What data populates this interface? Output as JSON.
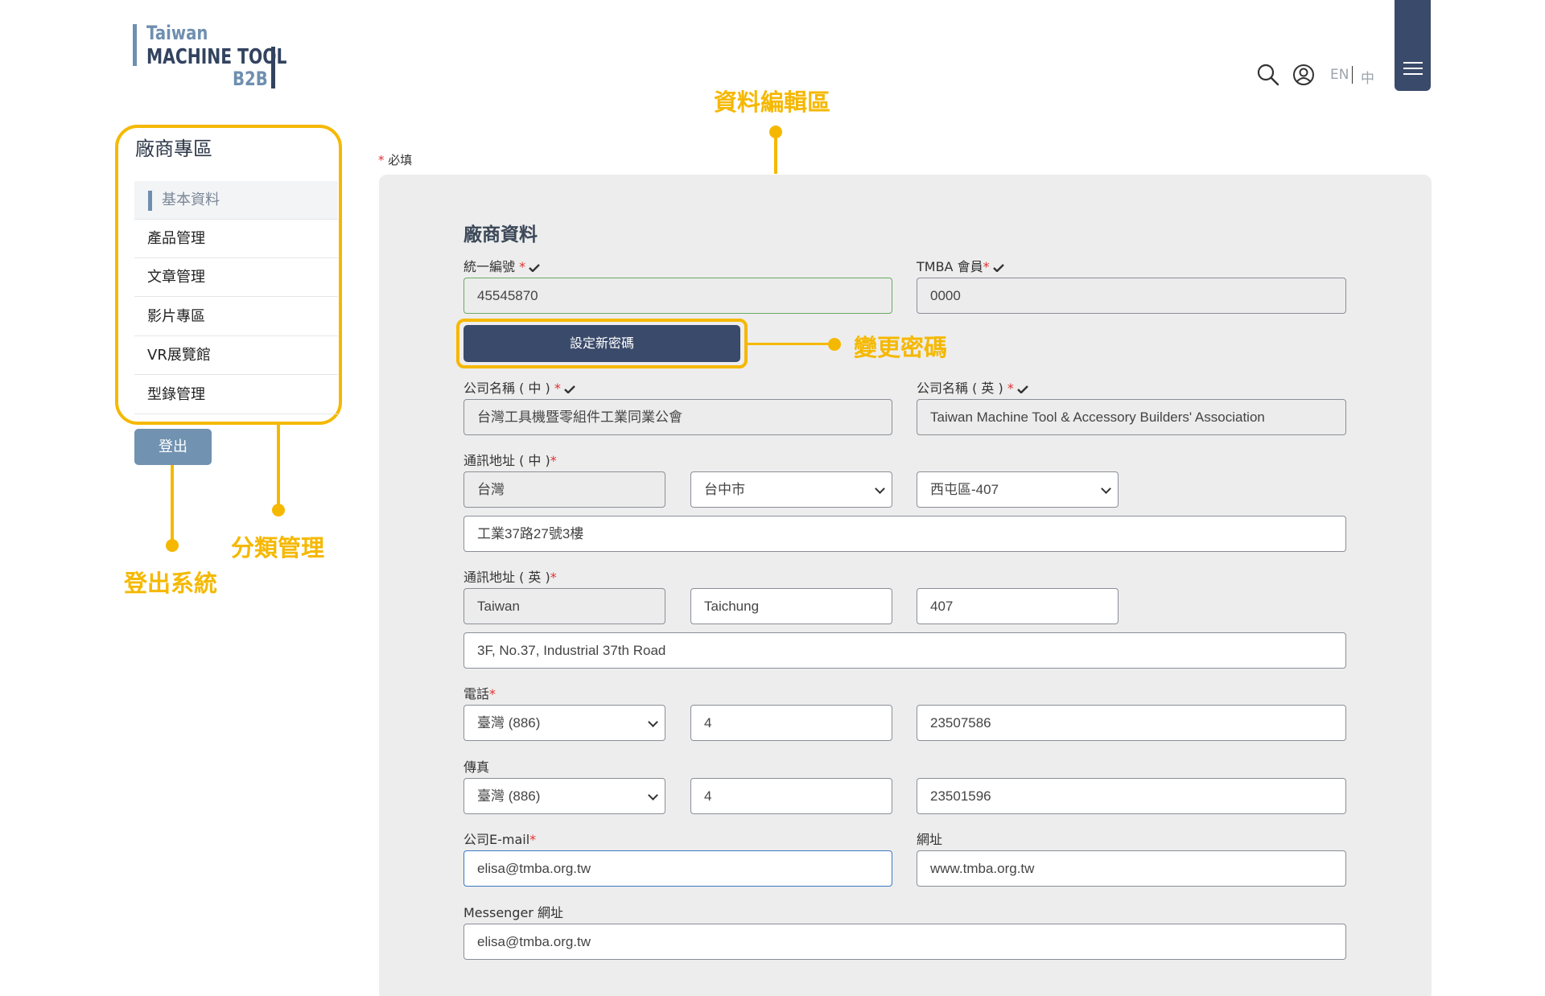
{
  "logo": {
    "line1": "Taiwan",
    "line2": "MACHINE TOOL",
    "line3": "B2B"
  },
  "header": {
    "lang_en": "EN",
    "lang_zh": "中",
    "icons": [
      "search-icon",
      "user-icon",
      "hamburger-menu-icon"
    ]
  },
  "annotations": {
    "edit_area": "資料編輯區",
    "change_password": "變更密碼",
    "category_manage": "分類管理",
    "logout_system": "登出系統",
    "color": "#f5b800"
  },
  "sidebar": {
    "title": "廠商專區",
    "items": [
      {
        "label": "基本資料"
      },
      {
        "label": "產品管理"
      },
      {
        "label": "文章管理"
      },
      {
        "label": "影片專區"
      },
      {
        "label": "VR展覽館"
      },
      {
        "label": "型錄管理"
      }
    ],
    "logout_label": "登出"
  },
  "required_note": {
    "star": "*",
    "text": "必填"
  },
  "form": {
    "section_title": "廠商資料",
    "tax_id": {
      "label": "統一編號",
      "star": "*",
      "value": "45545870"
    },
    "tmba": {
      "label": "TMBA 會員",
      "star": "*",
      "value": "0000"
    },
    "set_password_label": "設定新密碼",
    "company_zh": {
      "label": "公司名稱 ( 中 )",
      "star": "*",
      "value": "台灣工具機暨零組件工業同業公會"
    },
    "company_en": {
      "label": "公司名稱 ( 英 )",
      "star": "*",
      "value": "Taiwan Machine Tool & Accessory Builders' Association"
    },
    "addr_zh": {
      "label": "通訊地址 ( 中 )",
      "star": "*",
      "country": "台灣",
      "city": "台中市",
      "district": "西屯區-407",
      "street": "工業37路27號3樓"
    },
    "addr_en": {
      "label": "通訊地址 ( 英 )",
      "star": "*",
      "country": "Taiwan",
      "city": "Taichung",
      "zip": "407",
      "street": "3F, No.37, Industrial 37th Road"
    },
    "phone": {
      "label": "電話",
      "star": "*",
      "country": "臺灣 (886)",
      "area": "4",
      "number": "23507586"
    },
    "fax": {
      "label": "傳真",
      "country": "臺灣 (886)",
      "area": "4",
      "number": "23501596"
    },
    "email": {
      "label": "公司E-mail",
      "star": "*",
      "value": "elisa@tmba.org.tw"
    },
    "website": {
      "label": "網址",
      "value": "www.tmba.org.tw"
    },
    "messenger": {
      "label": "Messenger 網址",
      "value": "elisa@tmba.org.tw"
    }
  }
}
